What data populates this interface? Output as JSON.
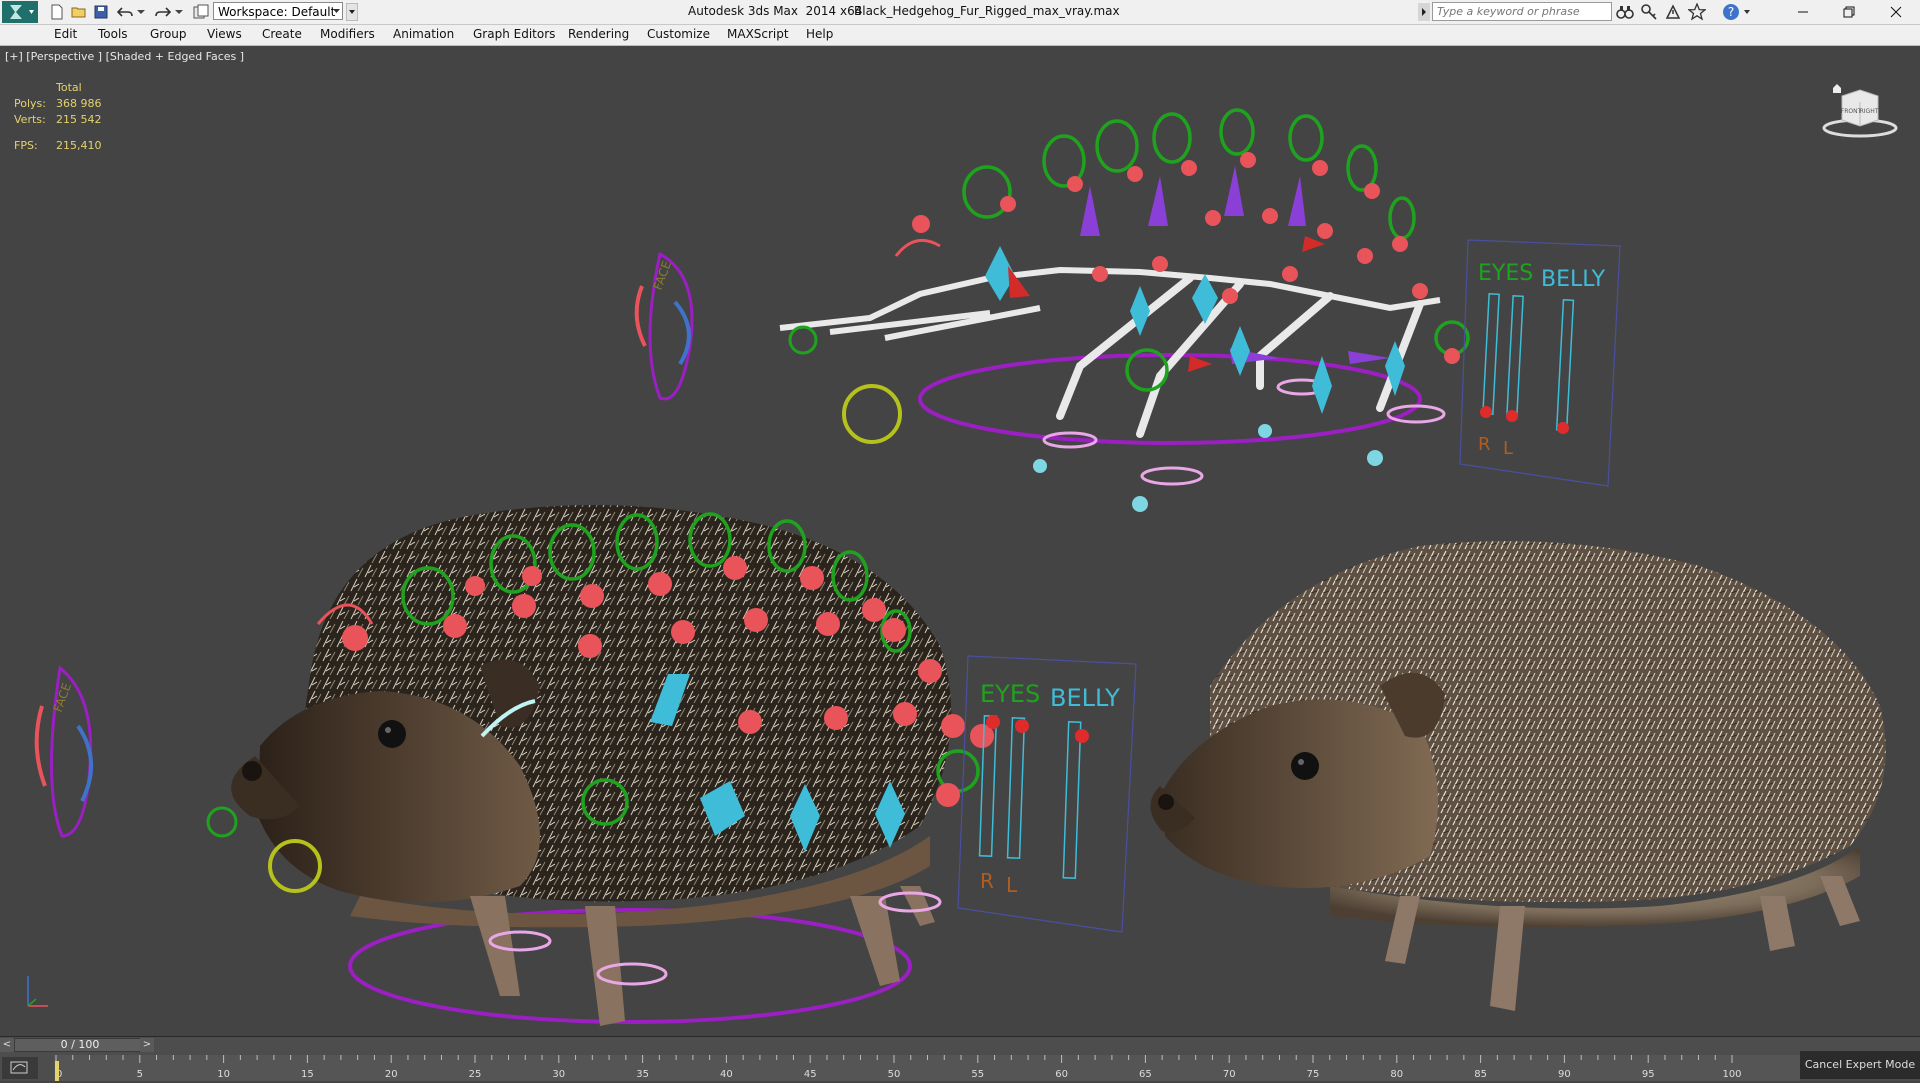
{
  "app": {
    "title": "Autodesk 3ds Max  2014 x64",
    "filename": "Black_Hedgehog_Fur_Rigged_max_vray.max",
    "workspace": "Workspace: Default",
    "search_placeholder": "Type a keyword or phrase"
  },
  "menus": [
    "Edit",
    "Tools",
    "Group",
    "Views",
    "Create",
    "Modifiers",
    "Animation",
    "Graph Editors",
    "Rendering",
    "Customize",
    "MAXScript",
    "Help"
  ],
  "viewport": {
    "label": "[+] [Perspective ] [Shaded + Edged Faces ]",
    "stats": {
      "header": "Total",
      "polys_label": "Polys:",
      "polys": "368 986",
      "verts_label": "Verts:",
      "verts": "215 542",
      "fps_label": "FPS:",
      "fps": "215,410"
    },
    "viewcube": {
      "face_left": "FRONT",
      "face_right": "RIGHT"
    },
    "panels": [
      {
        "title_left": "EYES",
        "title_right": "BELLY",
        "left_label": "R",
        "mid_label": "L"
      },
      {
        "title_left": "EYES",
        "title_right": "BELLY",
        "left_label": "R",
        "mid_label": "L"
      }
    ],
    "control_labels": [
      "FACE",
      "FACE"
    ]
  },
  "timeline": {
    "current": 0,
    "end": 100,
    "display": "0 / 100",
    "ticks": [
      "0",
      "5",
      "10",
      "15",
      "20",
      "25",
      "30",
      "35",
      "40",
      "45",
      "50",
      "55",
      "60",
      "65",
      "70",
      "75",
      "80",
      "85",
      "90",
      "95",
      "100"
    ]
  },
  "expert_mode_button": "Cancel Expert Mode",
  "colors": {
    "viewport_bg": "#444444",
    "stats_text": "#e6d26a",
    "control_green": "#1fa31f",
    "control_red": "#e8545a",
    "control_cyan": "#3fbcd8",
    "control_purple": "#9b1fc2",
    "control_pink": "#e9a7e6",
    "control_yellow": "#b6c21c"
  }
}
